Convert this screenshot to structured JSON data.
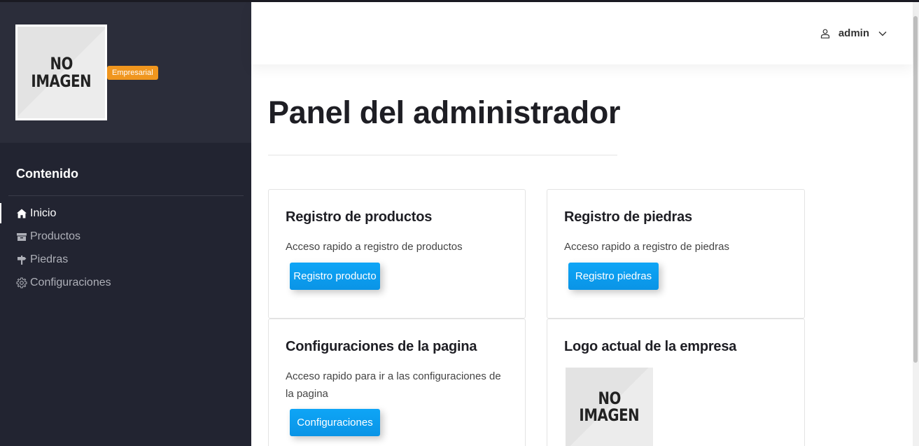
{
  "sidebar": {
    "logo_text_line1": "NO",
    "logo_text_line2": "IMAGEN",
    "badge": "Empresarial",
    "heading": "Contenido",
    "items": [
      {
        "label": "Inicio",
        "icon": "home-icon",
        "active": true
      },
      {
        "label": "Productos",
        "icon": "box-icon",
        "active": false
      },
      {
        "label": "Piedras",
        "icon": "signpost-icon",
        "active": false
      },
      {
        "label": "Configuraciones",
        "icon": "gear-icon",
        "active": false
      }
    ]
  },
  "header": {
    "user": "admin",
    "user_icon": "user-icon",
    "dropdown_icon": "chevron-down-icon"
  },
  "main": {
    "title": "Panel del administrador",
    "cards": [
      {
        "title": "Registro de productos",
        "text": "Acceso rapido a registro de productos",
        "button": "Registro producto"
      },
      {
        "title": "Registro de piedras",
        "text": "Acceso rapido a registro de piedras",
        "button": "Registro piedras"
      },
      {
        "title": "Configuraciones de la pagina",
        "text": "Acceso rapido para ir a las configuraciones de la pagina",
        "button": "Configuraciones"
      },
      {
        "title": "Logo actual de la empresa",
        "logo_text_line1": "NO",
        "logo_text_line2": "IMAGEN"
      }
    ]
  },
  "colors": {
    "sidebar_bg": "#222431",
    "sidebar_top_bg": "#2b2d3a",
    "badge": "#f0961e",
    "button": "#0ea5f6",
    "title": "#1e1e24"
  }
}
